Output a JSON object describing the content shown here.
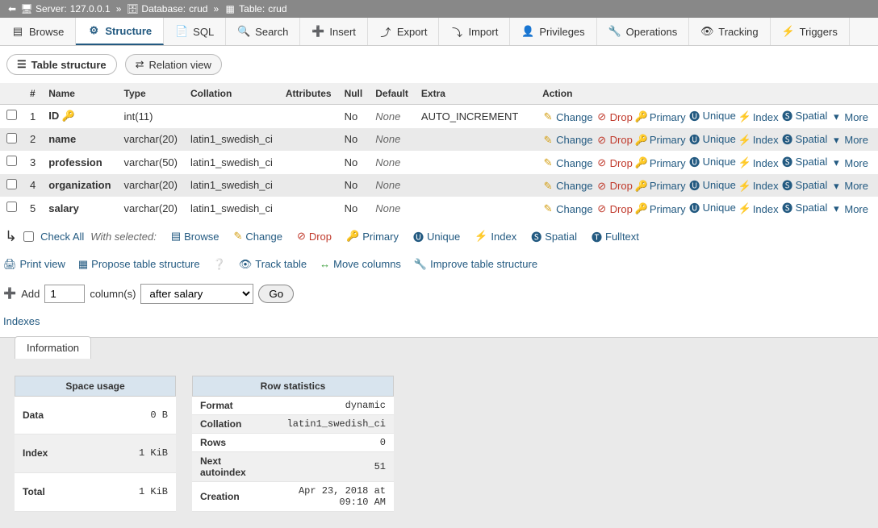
{
  "breadcrumb": {
    "server_label": "Server:",
    "server_value": "127.0.0.1",
    "db_label": "Database:",
    "db_value": "crud",
    "table_label": "Table:",
    "table_value": "crud"
  },
  "topnav": {
    "browse": "Browse",
    "structure": "Structure",
    "sql": "SQL",
    "search": "Search",
    "insert": "Insert",
    "export": "Export",
    "import": "Import",
    "privileges": "Privileges",
    "operations": "Operations",
    "tracking": "Tracking",
    "triggers": "Triggers"
  },
  "subtabs": {
    "table_structure": "Table structure",
    "relation_view": "Relation view"
  },
  "headers": {
    "num": "#",
    "name": "Name",
    "type": "Type",
    "collation": "Collation",
    "attributes": "Attributes",
    "null": "Null",
    "default": "Default",
    "extra": "Extra",
    "action": "Action"
  },
  "columns": [
    {
      "n": "1",
      "name": "ID",
      "type": "int(11)",
      "collation": "",
      "null": "No",
      "default": "None",
      "extra": "AUTO_INCREMENT",
      "pk": true
    },
    {
      "n": "2",
      "name": "name",
      "type": "varchar(20)",
      "collation": "latin1_swedish_ci",
      "null": "No",
      "default": "None",
      "extra": "",
      "pk": false
    },
    {
      "n": "3",
      "name": "profession",
      "type": "varchar(50)",
      "collation": "latin1_swedish_ci",
      "null": "No",
      "default": "None",
      "extra": "",
      "pk": false
    },
    {
      "n": "4",
      "name": "organization",
      "type": "varchar(20)",
      "collation": "latin1_swedish_ci",
      "null": "No",
      "default": "None",
      "extra": "",
      "pk": false
    },
    {
      "n": "5",
      "name": "salary",
      "type": "varchar(20)",
      "collation": "latin1_swedish_ci",
      "null": "No",
      "default": "None",
      "extra": "",
      "pk": false
    }
  ],
  "actions": {
    "change": "Change",
    "drop": "Drop",
    "primary": "Primary",
    "unique": "Unique",
    "index": "Index",
    "spatial": "Spatial",
    "more": "More"
  },
  "checkall": {
    "label": "Check All",
    "with_selected": "With selected:",
    "browse": "Browse",
    "change": "Change",
    "drop": "Drop",
    "primary": "Primary",
    "unique": "Unique",
    "index": "Index",
    "spatial": "Spatial",
    "fulltext": "Fulltext"
  },
  "linkbar": {
    "print": "Print view",
    "propose": "Propose table structure",
    "track": "Track table",
    "move": "Move columns",
    "improve": "Improve table structure"
  },
  "addrow": {
    "add_label": "Add",
    "count": "1",
    "cols_label": "column(s)",
    "position": "after salary",
    "go": "Go"
  },
  "indexes": "Indexes",
  "info_tab": "Information",
  "space_usage": {
    "caption": "Space usage",
    "data_label": "Data",
    "data_val": "0",
    "data_unit": "B",
    "index_label": "Index",
    "index_val": "1",
    "index_unit": "KiB",
    "total_label": "Total",
    "total_val": "1",
    "total_unit": "KiB"
  },
  "row_stats": {
    "caption": "Row statistics",
    "format_label": "Format",
    "format_val": "dynamic",
    "collation_label": "Collation",
    "collation_val": "latin1_swedish_ci",
    "rows_label": "Rows",
    "rows_val": "0",
    "next_label": "Next autoindex",
    "next_val": "51",
    "creation_label": "Creation",
    "creation_val": "Apr 23, 2018 at 09:10 AM"
  }
}
